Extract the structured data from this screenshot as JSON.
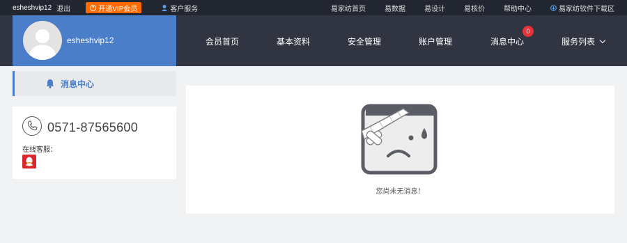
{
  "topbar": {
    "username": "esheshvip12",
    "logout": "退出",
    "vip_label": "开通VIP会员",
    "vip_icon": "vip-coin-icon",
    "customer_service": "客户服务",
    "cs_icon": "headset-icon",
    "links": [
      "易家纺首页",
      "易数据",
      "易设计",
      "易核价",
      "帮助中心",
      "易家纺软件下载区"
    ],
    "download_icon": "download-icon"
  },
  "profile": {
    "username": "esheshvip12",
    "avatar_icon": "default-avatar-icon"
  },
  "nav": {
    "items": [
      "会员首页",
      "基本资料",
      "安全管理",
      "账户管理",
      "消息中心",
      "服务列表"
    ],
    "message_badge": "0",
    "accent": "#4a7ec9",
    "badge_color": "#e8323a"
  },
  "sidebar": {
    "message_center": "消息中心",
    "bell_icon": "bell-icon",
    "phone": "0571-87565600",
    "phone_icon": "phone-icon",
    "online_service": "在线客服：",
    "qq_icon": "qq-icon"
  },
  "main": {
    "empty_text": "您尚未无消息！",
    "empty_icon": "sad-bandaged-face-icon"
  },
  "colors": {
    "topbar_bg": "#222631",
    "header_bg": "#303541",
    "vip_orange": "#ff6a00",
    "page_bg": "#f1f2f4"
  }
}
